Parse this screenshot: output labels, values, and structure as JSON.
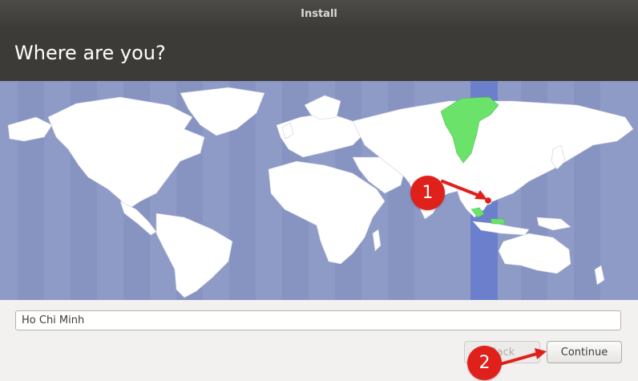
{
  "window": {
    "title": "Install"
  },
  "header": {
    "title": "Where are you?"
  },
  "map": {
    "ocean_color": "#8f9bc7",
    "land_color": "#ffffff",
    "highlighted_timezone_color": "#6b7fcc",
    "selected_region_color": "#6be36b",
    "pin_color": "#e0201b"
  },
  "location_field": {
    "value": "Ho Chi Minh"
  },
  "buttons": {
    "back_label": "Back",
    "continue_label": "Continue"
  },
  "annotations": {
    "marker_1": "1",
    "marker_2": "2",
    "color": "#e0201b"
  }
}
